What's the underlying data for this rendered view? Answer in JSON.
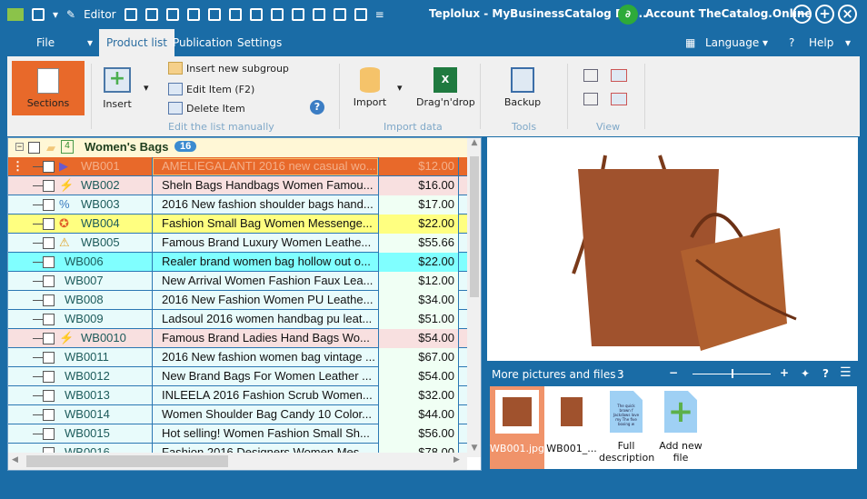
{
  "titlebar": {
    "editor_label": "Editor",
    "title": "Teplolux - MyBusinessCatalog Pla...",
    "account": "Account TheCatalog.Online",
    "minimize": "−",
    "maximize": "+",
    "close": "×"
  },
  "menu": {
    "tabs": [
      "File",
      "Product list",
      "Publication",
      "Settings"
    ],
    "active": "Product list",
    "language": "Language",
    "help": "Help"
  },
  "ribbon": {
    "sections": "Sections",
    "insert": "Insert",
    "insert_subgroup": "Insert new subgroup",
    "edit_item": "Edit Item  (F2)",
    "delete_item": "Delete Item",
    "group_edit": "Edit the list manually",
    "import": "Import",
    "dragdrop": "Drag'n'drop",
    "group_import": "Import data",
    "backup": "Backup",
    "group_tools": "Tools",
    "group_view": "View"
  },
  "group": {
    "name": "Women's Bags",
    "count": "16",
    "level": "4"
  },
  "rows": [
    {
      "id": "WB001",
      "desc": "AMELIEGALANTI 2016 new casual wo...",
      "price": "$12.00",
      "bg": "#e8692a",
      "marker": "flag",
      "selected": true
    },
    {
      "id": "WB002",
      "desc": "Sheln Bags Handbags Women Famou...",
      "price": "$16.00",
      "bg": "#f8e0e0",
      "marker": "lightning"
    },
    {
      "id": "WB003",
      "desc": "2016 New fashion shoulder bags hand...",
      "price": "$17.00",
      "bg": "#e8fbfb",
      "marker": "percent"
    },
    {
      "id": "WB004",
      "desc": "Fashion Small Bag Women Messenge...",
      "price": "$22.00",
      "bg": "#ffff80",
      "marker": "award"
    },
    {
      "id": "WB005",
      "desc": "Famous Brand Luxury Women Leathe...",
      "price": "$55.66",
      "bg": "#e8fbfb",
      "marker": "warning"
    },
    {
      "id": "WB006",
      "desc": "Realer brand women bag hollow out o...",
      "price": "$22.00",
      "bg": "#80ffff"
    },
    {
      "id": "WB007",
      "desc": "New Arrival Women Fashion Faux Lea...",
      "price": "$12.00",
      "bg": "#e8fbfb"
    },
    {
      "id": "WB008",
      "desc": "2016 New Fashion Women PU Leathe...",
      "price": "$34.00",
      "bg": "#e8fbfb"
    },
    {
      "id": "WB009",
      "desc": "Ladsoul 2016 women handbag pu leat...",
      "price": "$51.00",
      "bg": "#e8fbfb"
    },
    {
      "id": "WB0010",
      "desc": "Famous Brand Ladies Hand Bags Wo...",
      "price": "$54.00",
      "bg": "#f8e0e0",
      "marker": "lightning"
    },
    {
      "id": "WB0011",
      "desc": "2016 New fashion women bag vintage ...",
      "price": "$67.00",
      "bg": "#e8fbfb"
    },
    {
      "id": "WB0012",
      "desc": "New Brand Bags For Women Leather ...",
      "price": "$54.00",
      "bg": "#e8fbfb"
    },
    {
      "id": "WB0013",
      "desc": "INLEELA 2016 Fashion Scrub Women...",
      "price": "$32.00",
      "bg": "#e8fbfb"
    },
    {
      "id": "WB0014",
      "desc": "Women Shoulder Bag Candy 10 Color...",
      "price": "$44.00",
      "bg": "#e8fbfb"
    },
    {
      "id": "WB0015",
      "desc": "Hot selling! Women Fashion Small Sh...",
      "price": "$56.00",
      "bg": "#e8fbfb"
    },
    {
      "id": "WB0016",
      "desc": "Fashion 2016 Designers Women Mes...",
      "price": "$78.00",
      "bg": "#e8fbfb"
    }
  ],
  "files": {
    "label": "More pictures and files :",
    "count": "3",
    "zoom_fraction": 0.5,
    "items": [
      {
        "name": "WB001.jpg",
        "selected": true
      },
      {
        "name": "WB001_..."
      },
      {
        "name": "Full description"
      },
      {
        "name": "Add new file"
      }
    ],
    "doc_text": "The quick brown f Jackdaws love my The five boxing w"
  }
}
